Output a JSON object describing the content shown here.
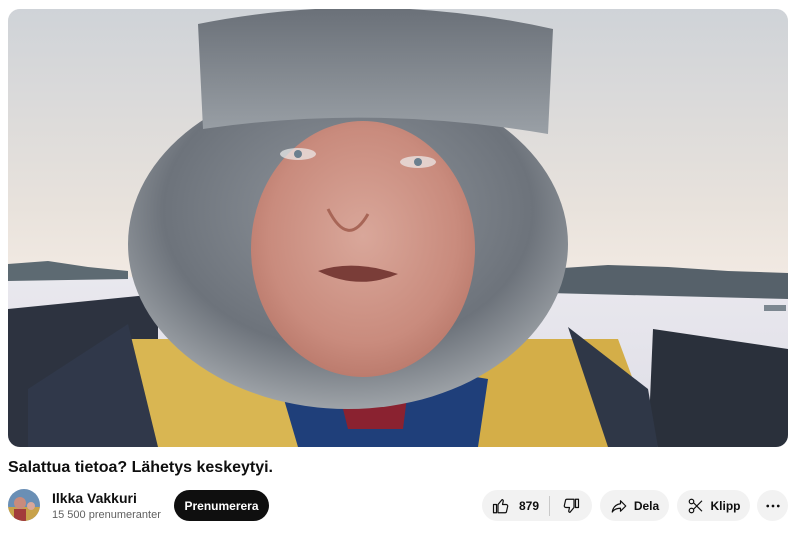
{
  "video": {
    "title": "Salattua tietoa? Lähetys keskeytyi."
  },
  "channel": {
    "name": "Ilkka Vakkuri",
    "subscribers": "15 500 prenumeranter",
    "subscribe_label": "Prenumerera"
  },
  "actions": {
    "like_count": "879",
    "share_label": "Dela",
    "clip_label": "Klipp"
  },
  "icons": {
    "like": "thumbs-up-icon",
    "dislike": "thumbs-down-icon",
    "share": "share-arrow-icon",
    "clip": "scissors-icon",
    "more": "more-dots-icon"
  }
}
